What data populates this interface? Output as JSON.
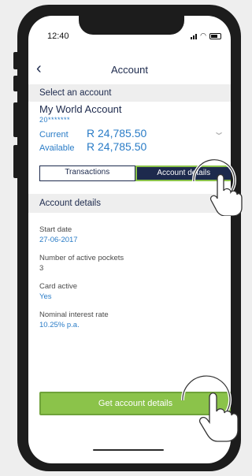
{
  "status": {
    "time": "12:40"
  },
  "nav": {
    "title": "Account"
  },
  "select_header": "Select an account",
  "account": {
    "name": "My World Account",
    "number": "20*******",
    "current_label": "Current",
    "current_value": "R 24,785.50",
    "available_label": "Available",
    "available_value": "R 24,785.50"
  },
  "tabs": [
    {
      "label": "Transactions",
      "active": false
    },
    {
      "label": "Account details",
      "active": true
    }
  ],
  "details_header": "Account details",
  "details": [
    {
      "label": "Start date",
      "value": "27-06-2017"
    },
    {
      "label": "Number of active pockets",
      "value": "3"
    },
    {
      "label": "Card active",
      "value": "Yes"
    },
    {
      "label": "Nominal interest rate",
      "value": "10.25% p.a."
    }
  ],
  "cta_label": "Get account details",
  "icons": [
    "back-chevron-icon",
    "chevron-down-icon",
    "signal-icon",
    "wifi-icon",
    "battery-icon",
    "tap-hand-icon"
  ],
  "colors": {
    "navy": "#1d2a4d",
    "blue": "#2a7cc7",
    "green": "#8bc34a"
  }
}
